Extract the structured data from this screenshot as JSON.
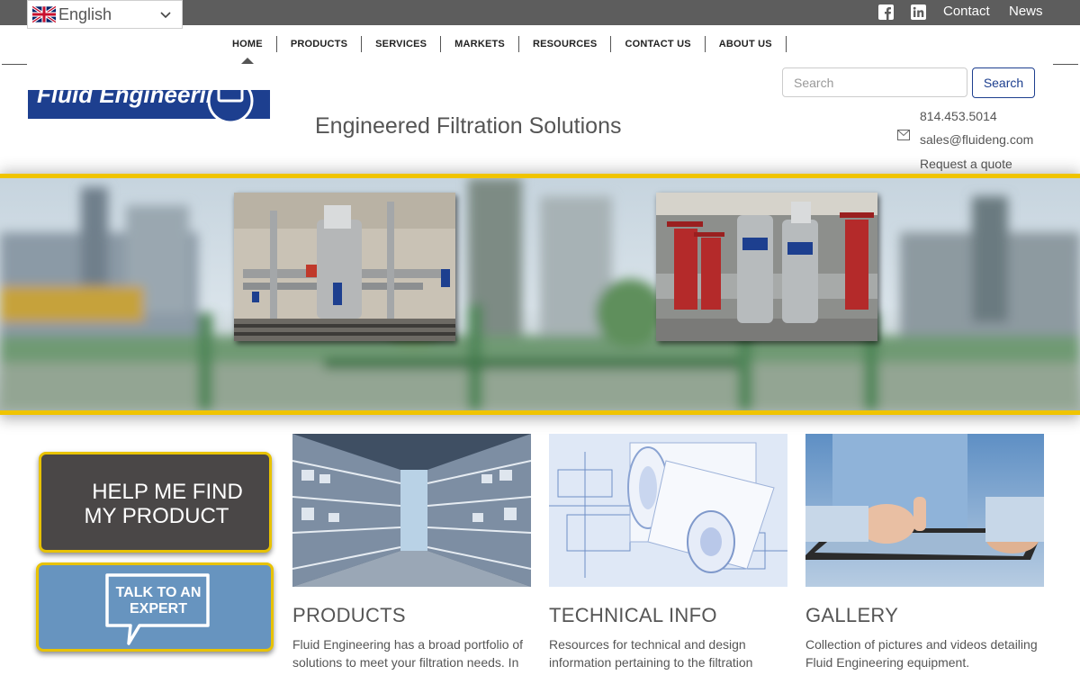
{
  "language_selector": {
    "label": "English",
    "flag_icon": "uk-flag-icon"
  },
  "topbar": {
    "social_icons": [
      "facebook-icon",
      "linkedin-icon"
    ],
    "links": [
      "Contact",
      "News"
    ]
  },
  "nav": {
    "items": [
      "HOME",
      "PRODUCTS",
      "SERVICES",
      "MARKETS",
      "RESOURCES",
      "CONTACT US",
      "ABOUT US"
    ],
    "active": "HOME"
  },
  "header": {
    "logo_text": "Fluid Engineering",
    "tagline": "Engineered Filtration Solutions",
    "search_placeholder": "Search",
    "search_button": "Search",
    "phone": "814.453.5014",
    "email": "sales@fluideng.com",
    "quote_link": "Request a quote"
  },
  "cta": {
    "find_line1": "HELP ME FIND",
    "find_line2": "MY PRODUCT",
    "expert_line1": "TALK TO AN",
    "expert_line2": "EXPERT"
  },
  "cards": [
    {
      "title": "PRODUCTS",
      "desc": "Fluid Engineering has a broad portfolio of solutions to meet your filtration needs. In"
    },
    {
      "title": "TECHNICAL INFO",
      "desc": "Resources for technical and design information pertaining to the filtration"
    },
    {
      "title": "GALLERY",
      "desc": "Collection of pictures and videos detailing Fluid Engineering equipment."
    }
  ],
  "colors": {
    "accent_gold": "#f0c400",
    "brand_blue": "#1d3f8f",
    "topbar_gray": "#5d5d5d"
  }
}
